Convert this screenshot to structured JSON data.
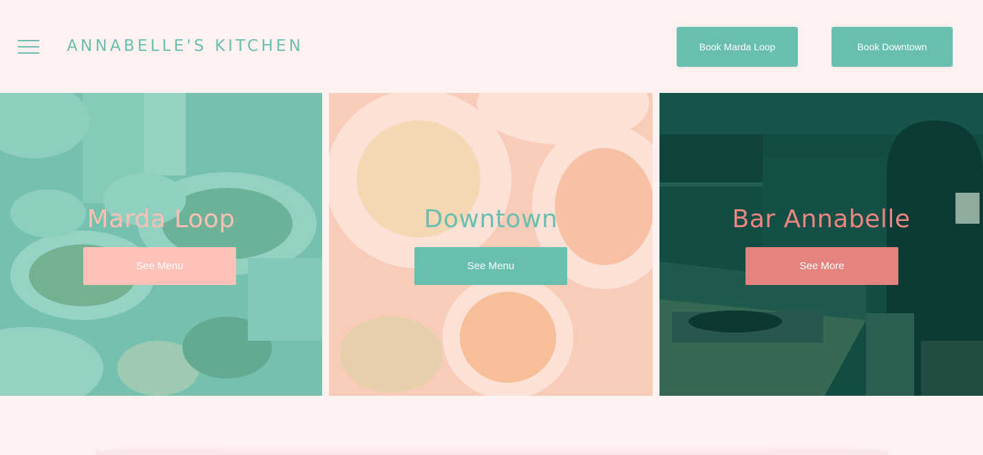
{
  "header": {
    "logo_text": "ANNABELLE'S KITCHEN",
    "menu_icon": "hamburger-menu-icon",
    "book_marda_label": "Book Marda Loop",
    "book_downtown_label": "Book Downtown"
  },
  "panels": [
    {
      "title": "Marda Loop",
      "button_label": "See Menu",
      "title_color": "#ffbfb3",
      "button_color": "#ffc2b8",
      "tint_color": "#7fcdbd"
    },
    {
      "title": "Downtown",
      "button_label": "See Menu",
      "title_color": "#68bfb0",
      "button_color": "#68bfb0",
      "tint_color": "#ffd7cc"
    },
    {
      "title": "Bar Annabelle",
      "button_label": "See More",
      "title_color": "#ec8680",
      "button_color": "#e5837e",
      "tint_color": "#0f4a42"
    }
  ],
  "colors": {
    "background": "#fff1f0",
    "accent": "#68bfb0"
  }
}
